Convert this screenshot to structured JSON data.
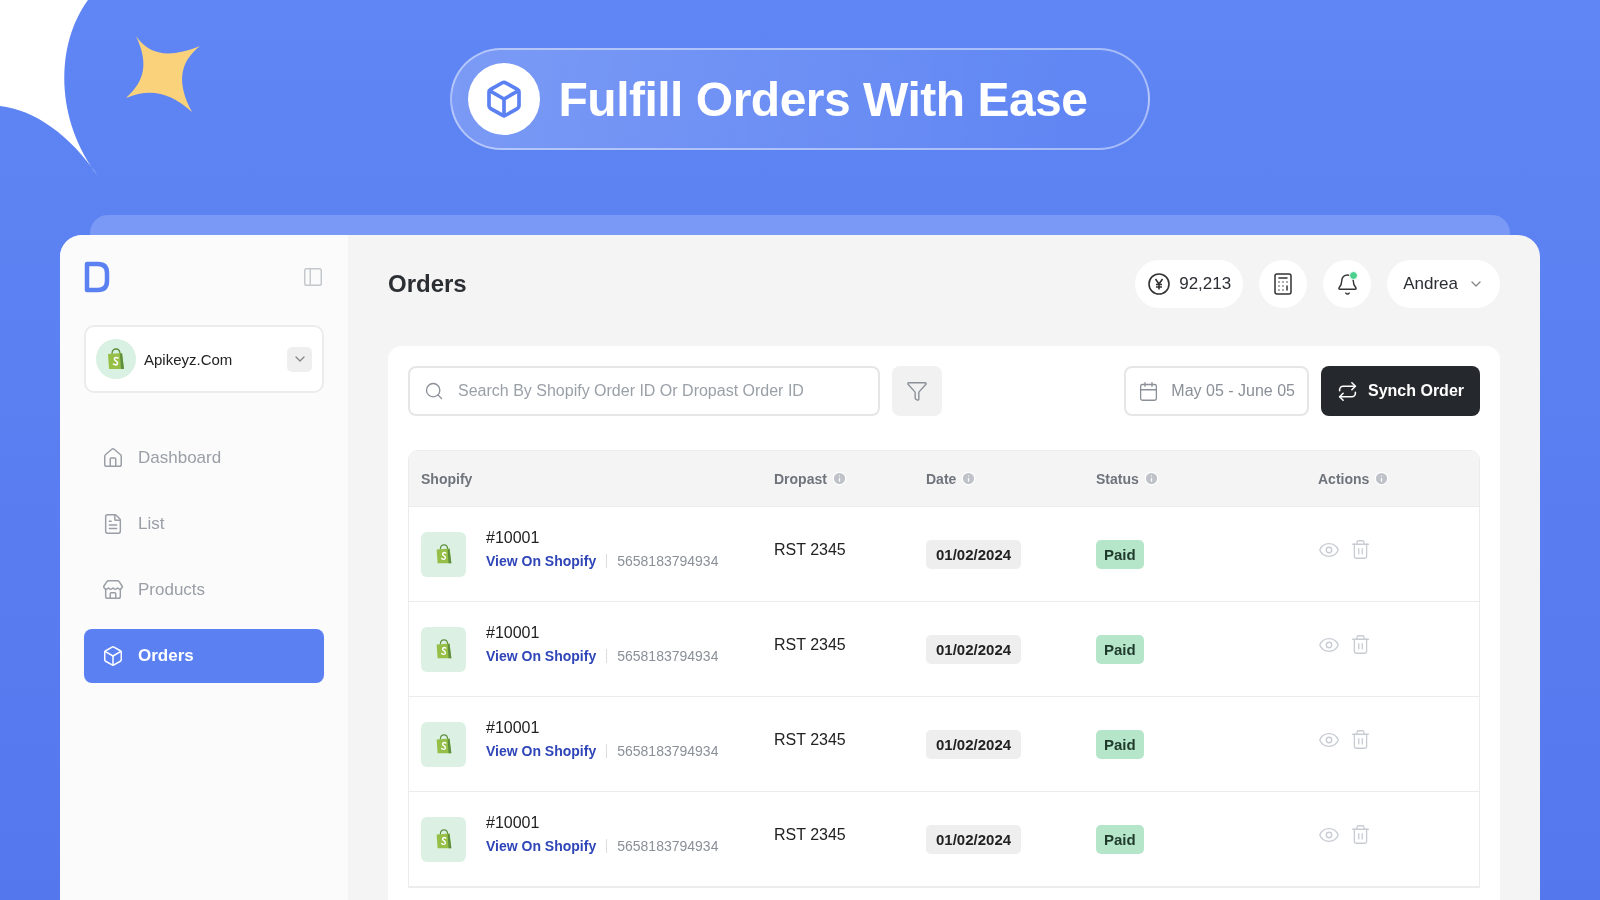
{
  "banner": {
    "title": "Fulfill Orders With Ease"
  },
  "sidebar": {
    "store": {
      "name": "Apikeyz.Com"
    },
    "items": [
      {
        "label": "Dashboard",
        "kind": "home",
        "selected": false
      },
      {
        "label": "List",
        "kind": "document",
        "selected": false
      },
      {
        "label": "Products",
        "kind": "store",
        "selected": false
      },
      {
        "label": "Orders",
        "kind": "box",
        "selected": true
      }
    ]
  },
  "header": {
    "title": "Orders",
    "balance": "92,213",
    "notification": true,
    "user": "Andrea"
  },
  "toolbar": {
    "search_placeholder": "Search By Shopify Order ID Or Dropast Order ID",
    "date_range": "May 05 - June 05",
    "sync_button": "Synch Order"
  },
  "table": {
    "columns": [
      {
        "label": "Shopify",
        "info": false
      },
      {
        "label": "Dropast",
        "info": true
      },
      {
        "label": "Date",
        "info": true
      },
      {
        "label": "Status",
        "info": true
      },
      {
        "label": "Actions",
        "info": true
      }
    ],
    "rows": [
      {
        "order": "#10001",
        "link": "View On Shopify",
        "shopify_id": "5658183794934",
        "dropast": "RST 2345",
        "date": "01/02/2024",
        "status": "Paid"
      },
      {
        "order": "#10001",
        "link": "View On Shopify",
        "shopify_id": "5658183794934",
        "dropast": "RST 2345",
        "date": "01/02/2024",
        "status": "Paid"
      },
      {
        "order": "#10001",
        "link": "View On Shopify",
        "shopify_id": "5658183794934",
        "dropast": "RST 2345",
        "date": "01/02/2024",
        "status": "Paid"
      },
      {
        "order": "#10001",
        "link": "View On Shopify",
        "shopify_id": "5658183794934",
        "dropast": "RST 2345",
        "date": "01/02/2024",
        "status": "Paid"
      }
    ]
  }
}
